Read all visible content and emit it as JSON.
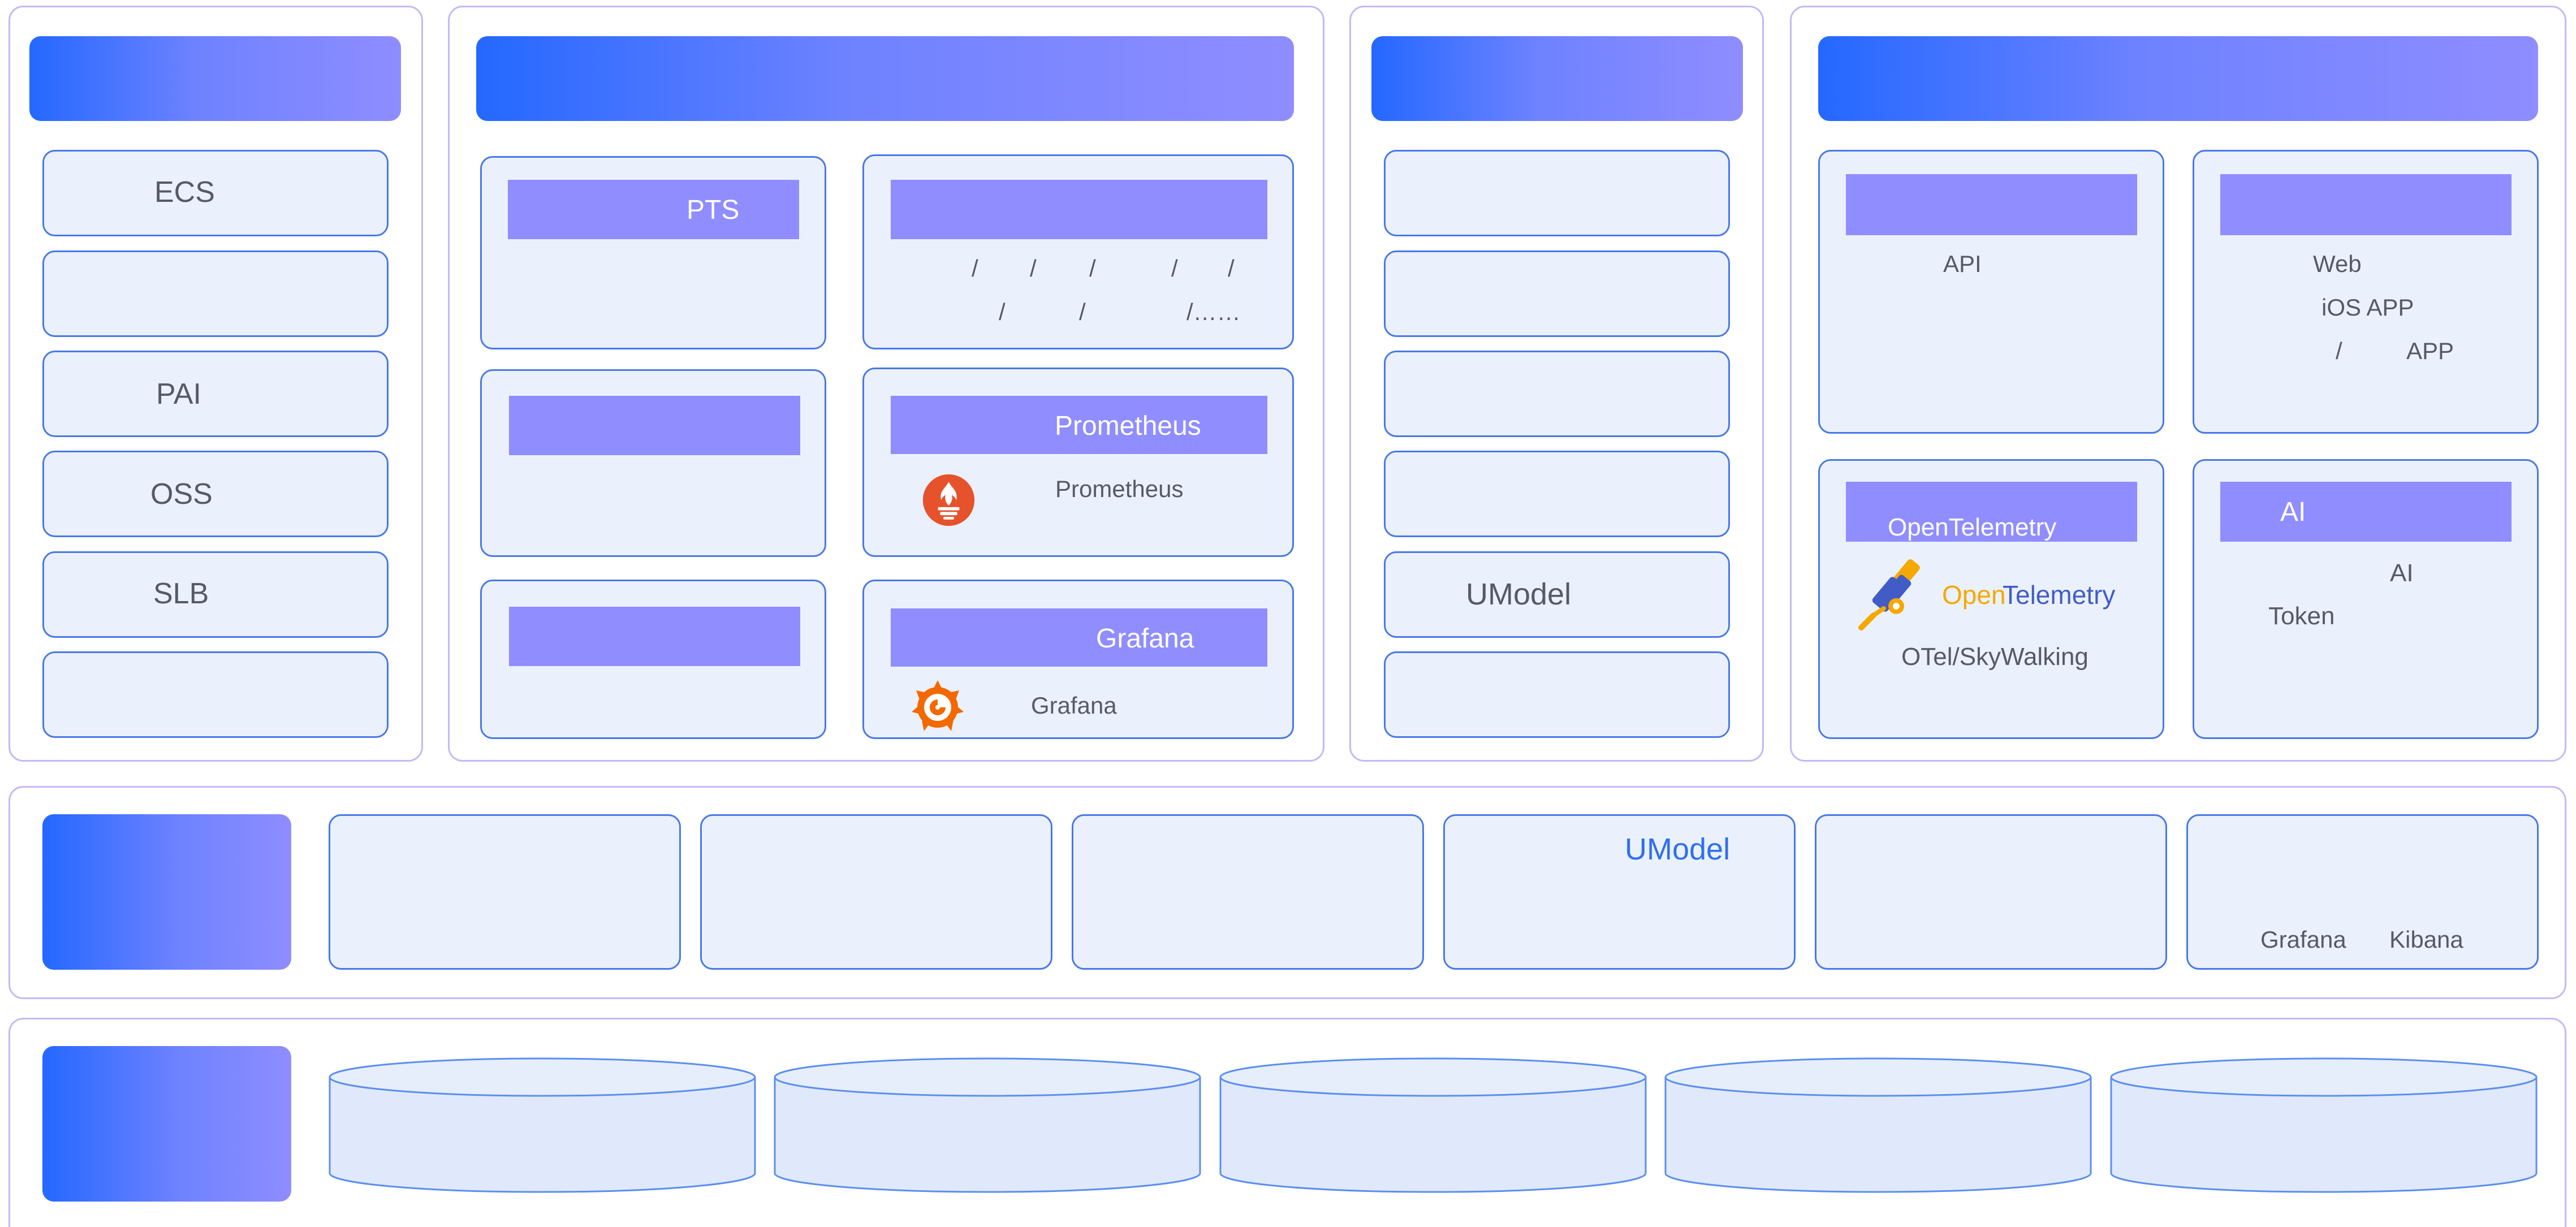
{
  "col1": {
    "items": [
      "ECS",
      "",
      "PAI",
      "OSS",
      "SLB",
      ""
    ]
  },
  "col2": {
    "pts": {
      "bar": "PTS"
    },
    "logs": {
      "row1": [
        "/",
        "/",
        "/",
        "/",
        "/"
      ],
      "row2": [
        "/",
        "/",
        "/……"
      ]
    },
    "prometheus": {
      "bar": "Prometheus",
      "text": "Prometheus"
    },
    "grafana": {
      "bar": "Grafana",
      "text": "Grafana"
    }
  },
  "col3": {
    "umodel": "UModel"
  },
  "col4": {
    "api": "API",
    "web": {
      "line1": "Web",
      "line2": "iOS APP",
      "line3_slash": "/",
      "line3_app": "APP"
    },
    "otel": {
      "bar": "OpenTelemetry",
      "logo_open": "Open",
      "logo_telemetry": "Telemetry",
      "caption": "OTel/SkyWalking"
    },
    "ai": {
      "bar": "AI",
      "line1": "AI",
      "line2": "Token"
    }
  },
  "middle": {
    "umodel": "UModel",
    "grafana": "Grafana",
    "kibana": "Kibana"
  },
  "colors": {
    "accent_blue": "#2468ff",
    "bar_purple": "#8f8dff",
    "border_purple": "#c6b8f4",
    "box_border": "#4978e8",
    "box_fill": "#ebf1fc",
    "prometheus_orange": "#e6522c",
    "grafana_orange": "#f46800",
    "otel_orange": "#f5a800",
    "otel_blue": "#425cc7"
  }
}
